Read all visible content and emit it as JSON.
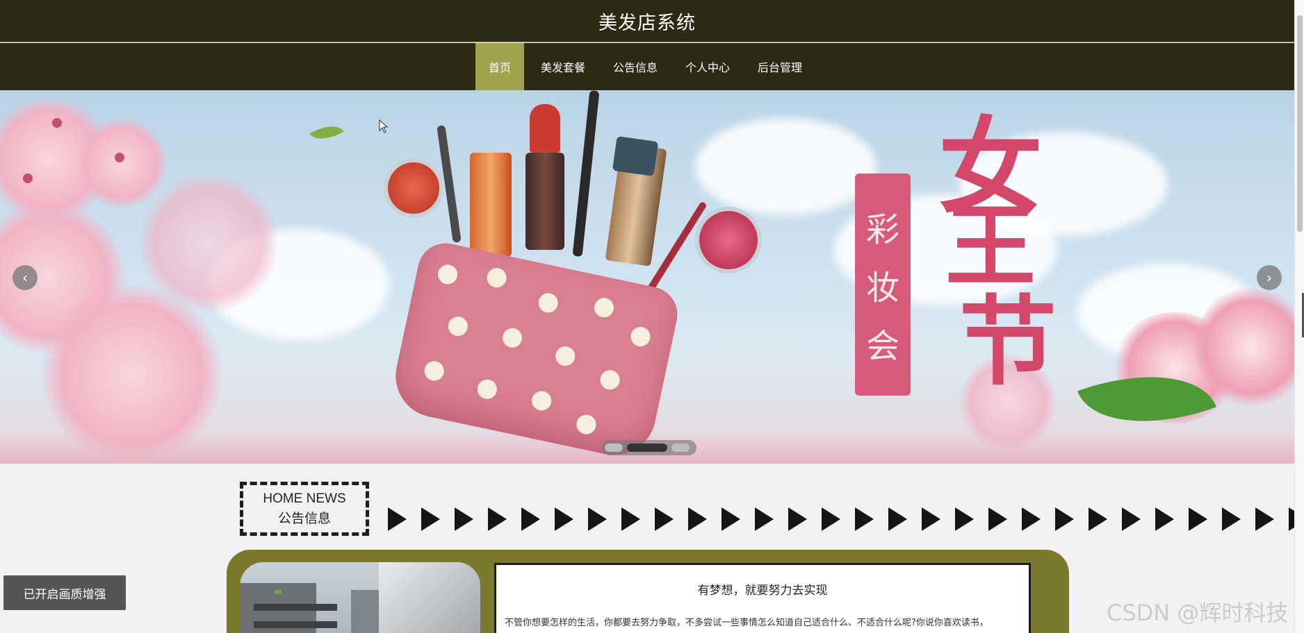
{
  "header": {
    "title": "美发店系统"
  },
  "nav": {
    "items": [
      {
        "label": "首页",
        "active": true
      },
      {
        "label": "美发套餐",
        "active": false
      },
      {
        "label": "公告信息",
        "active": false
      },
      {
        "label": "个人中心",
        "active": false
      },
      {
        "label": "后台管理",
        "active": false
      }
    ]
  },
  "banner": {
    "prev_icon": "chevron-left-icon",
    "next_icon": "chevron-right-icon",
    "prev_glyph": "‹",
    "next_glyph": "›",
    "slide_count": 3,
    "active_slide": 2,
    "vertical_text": [
      "彩",
      "妆",
      "会"
    ],
    "big_text": [
      "女",
      "王",
      "节"
    ]
  },
  "news_section": {
    "badge_en": "HOME NEWS",
    "badge_zh": "公告信息",
    "article": {
      "title": "有梦想，就要努力去实现",
      "desc": "不管你想要怎样的生活，你都要去努力争取，不多尝试一些事情怎么知道自己适合什么、不适合什么呢?你说你喜欢读书，"
    }
  },
  "overlay": {
    "enhance_label": "已开启画质增强",
    "watermark": "CSDN @辉时科技"
  },
  "colors": {
    "header_bg": "#2b2b13",
    "nav_active": "#a2a14e",
    "panel_olive": "#7b7a2c"
  }
}
